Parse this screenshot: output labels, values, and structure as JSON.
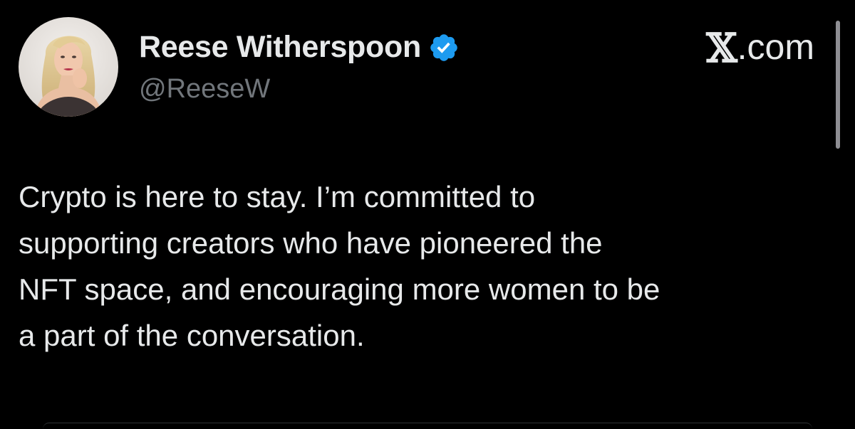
{
  "tweet": {
    "author": {
      "display_name": "Reese Witherspoon",
      "handle": "@ReeseW",
      "verified": true,
      "verified_color": "#1d9bf0",
      "avatar_icon": "profile-photo-avatar"
    },
    "source": {
      "mark": "𝕏",
      "domain": ".com"
    },
    "text": "Crypto is here to stay. I’m committed to\nsupporting creators who have pioneered the\nNFT space, and encouraging more women to be\na part of the conversation."
  },
  "theme": {
    "background": "#000000",
    "text_primary": "#e7e9ea",
    "text_secondary": "#71767b",
    "accent": "#1d9bf0"
  }
}
